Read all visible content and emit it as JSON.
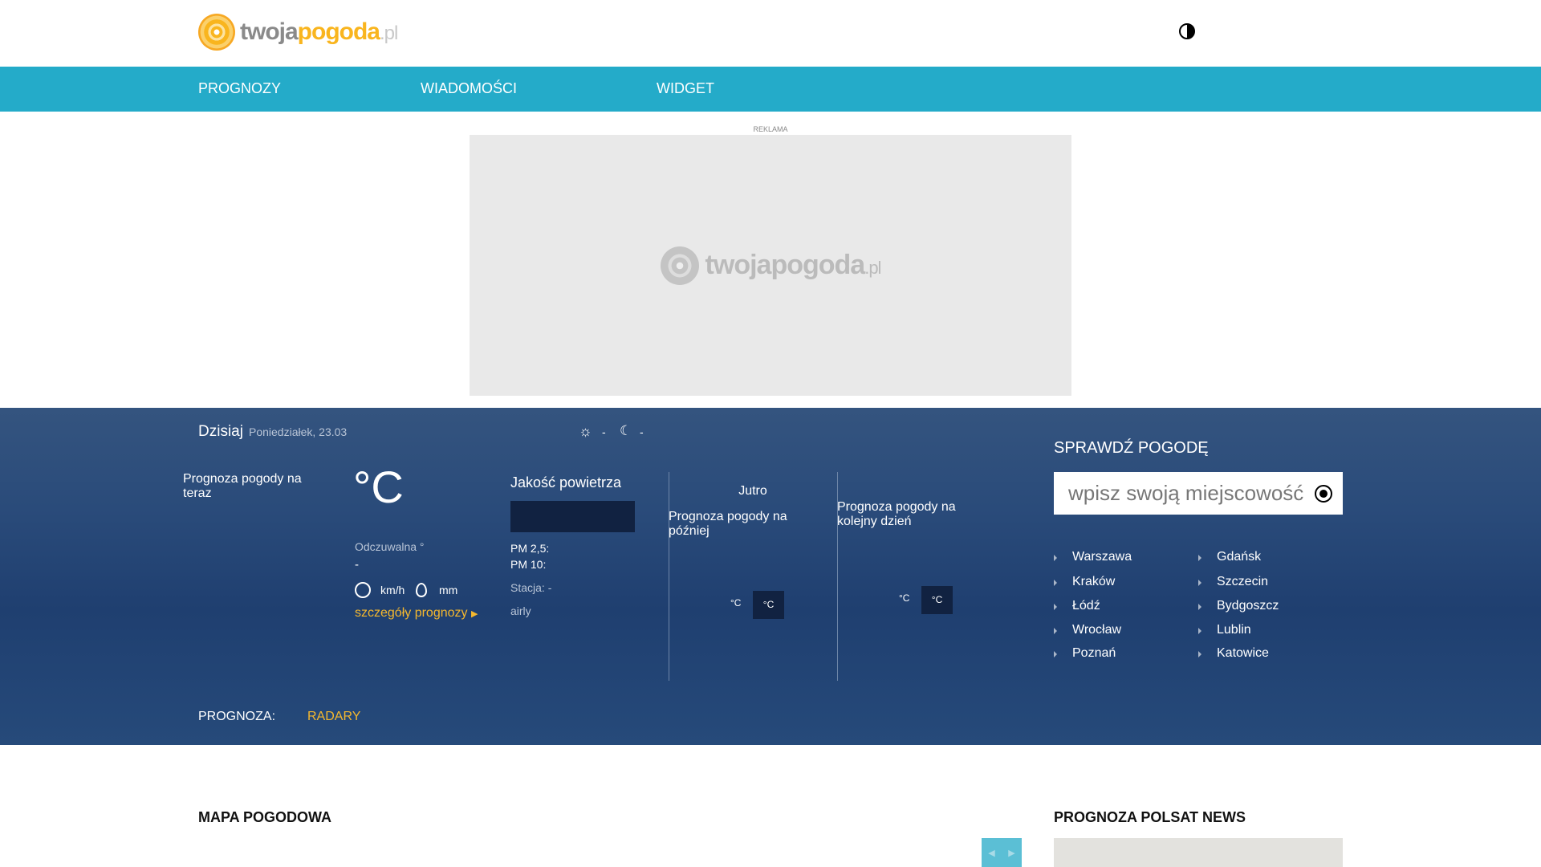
{
  "header": {
    "logo_part1": "twoja",
    "logo_part2": "pogoda",
    "logo_part3": ".pl",
    "contrast_icon": "contrast-icon"
  },
  "nav": [
    {
      "label": "PROGNOZY"
    },
    {
      "label": "WIADOMOŚCI"
    },
    {
      "label": "WIDGET"
    }
  ],
  "ad": {
    "label": "REKLAMA",
    "placeholder_logo": "twojapogoda.pl"
  },
  "today": {
    "title": "Dzisiaj",
    "date": "Poniedziałek, 23.03",
    "sun_value": "-",
    "moon_value": "-",
    "now_img_alt": "Prognoza pogody na teraz",
    "temp": "°C",
    "feels_like": "Odczuwalna °",
    "feels_value": "-",
    "wind_unit": "km/h",
    "rain_unit": "mm",
    "details_link": "szczegóły prognozy"
  },
  "air": {
    "title": "Jakość powietrza",
    "pm25": "PM 2,5:",
    "pm10": "PM 10:",
    "station": "Stacja: -",
    "provider": "airly"
  },
  "later": {
    "title": "Jutro",
    "img_alt": "Prognoza pogody na później",
    "temp_day": "°C",
    "temp_night": "°C"
  },
  "nextday": {
    "img_alt": "Prognoza pogody na kolejny dzień",
    "temp_day": "°C",
    "temp_night": "°C"
  },
  "sidebar": {
    "title": "SPRAWDŹ POGODĘ",
    "search_placeholder": "wpisz swoją miejscowość",
    "cities_left": [
      "Warszawa",
      "Kraków",
      "Łódź",
      "Wrocław",
      "Poznań"
    ],
    "cities_right": [
      "Gdańsk",
      "Szczecin",
      "Bydgoszcz",
      "Lublin",
      "Katowice"
    ]
  },
  "forecast_bar": {
    "label": "PROGNOZA:",
    "radary": "RADARY"
  },
  "sections": {
    "map": "MAPA POGODOWA",
    "polsat": "PROGNOZA POLSAT NEWS"
  },
  "colors": {
    "nav": "#24abc9",
    "accent": "#f5b82e",
    "hero": "#2a4b7a"
  }
}
